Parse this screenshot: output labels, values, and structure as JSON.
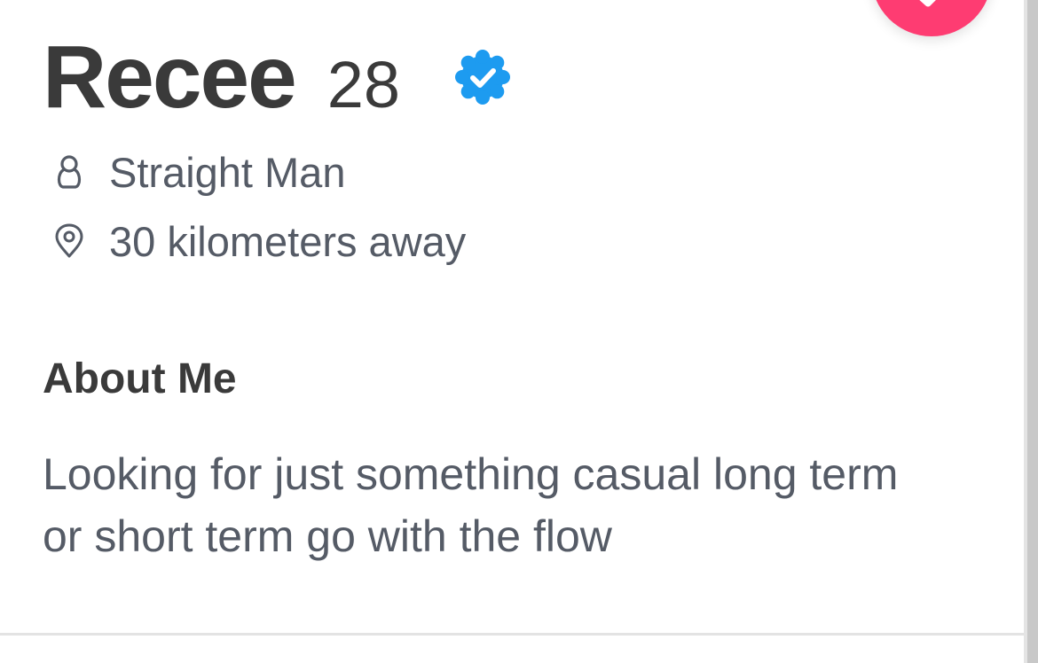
{
  "profile": {
    "name": "Recee",
    "age": "28",
    "verified": true,
    "gender": "Straight Man",
    "distance": "30 kilometers away"
  },
  "about": {
    "title": "About Me",
    "body": "Looking for just something casual long term or short term go with the flow"
  },
  "icons": {
    "verified": "verified-badge-icon",
    "gender": "person-icon",
    "distance": "location-pin-icon",
    "action": "check-icon"
  },
  "colors": {
    "accent": "#fe3c72",
    "verified": "#1d9bf0",
    "heading": "#3a3a3a",
    "body": "#555b66"
  }
}
